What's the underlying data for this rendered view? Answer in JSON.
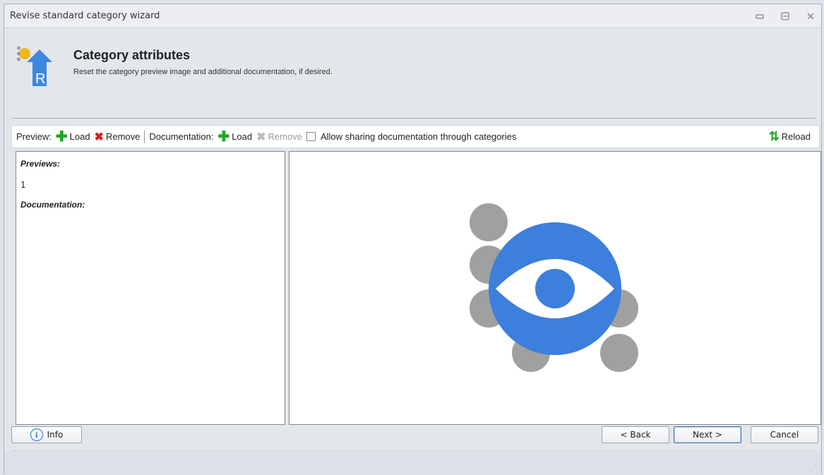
{
  "window": {
    "title": "Revise standard category wizard"
  },
  "header": {
    "title": "Category attributes",
    "subtitle": "Reset the category preview image and additional documentation, if desired.",
    "icon_letter": "R"
  },
  "toolbar": {
    "preview_label": "Preview:",
    "preview_load": "Load",
    "preview_remove": "Remove",
    "documentation_label": "Documentation:",
    "doc_load": "Load",
    "doc_remove": "Remove",
    "allow_sharing": "Allow sharing documentation through categories",
    "reload": "Reload"
  },
  "left_pane": {
    "previews_label": "Previews:",
    "previews": [
      "1"
    ],
    "documentation_label": "Documentation:"
  },
  "buttons": {
    "info": "Info",
    "back": "< Back",
    "next": "Next >",
    "cancel": "Cancel"
  },
  "colors": {
    "eye_blue": "#3d7fdc",
    "circle_gray": "#a0a0a0",
    "add_green": "#21a823",
    "remove_red": "#e21b1b"
  }
}
